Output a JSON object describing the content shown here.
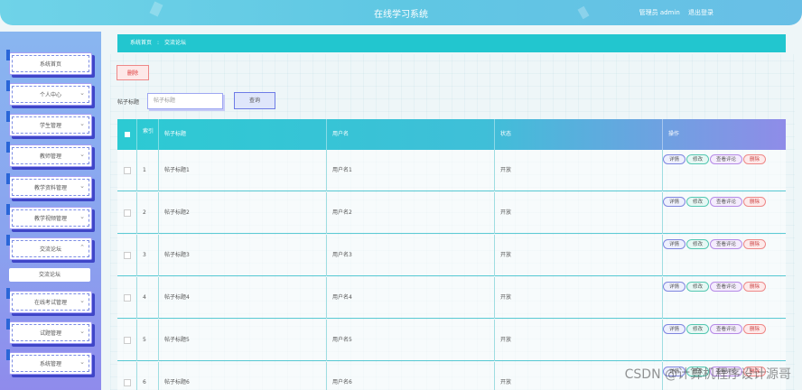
{
  "header": {
    "title": "在线学习系统",
    "user": "管理员 admin",
    "logout": "退出登录"
  },
  "sidebar": {
    "items": [
      {
        "label": "系统首页",
        "chevron": false
      },
      {
        "label": "个人中心",
        "chevron": true
      },
      {
        "label": "学生管理",
        "chevron": true
      },
      {
        "label": "教师管理",
        "chevron": true
      },
      {
        "label": "教学资料管理",
        "chevron": true
      },
      {
        "label": "教学视频管理",
        "chevron": true
      },
      {
        "label": "交流论坛",
        "chevron": true,
        "expanded": true
      },
      {
        "label": "在线考试管理",
        "chevron": true
      },
      {
        "label": "试题管理",
        "chevron": true
      },
      {
        "label": "系统管理",
        "chevron": true
      }
    ],
    "submenu": "交流论坛"
  },
  "breadcrumb": {
    "home": "系统首页",
    "sep": ":",
    "current": "交流论坛"
  },
  "toolbar": {
    "delete_label": "删除"
  },
  "search": {
    "label": "帖子标题",
    "placeholder": "帖子标题",
    "button": "查询"
  },
  "table": {
    "columns": [
      "索引",
      "帖子标题",
      "用户名",
      "状态",
      "操作"
    ],
    "rows": [
      {
        "index": "1",
        "title": "帖子标题1",
        "user": "用户名1",
        "status": "开放"
      },
      {
        "index": "2",
        "title": "帖子标题2",
        "user": "用户名2",
        "status": "开放"
      },
      {
        "index": "3",
        "title": "帖子标题3",
        "user": "用户名3",
        "status": "开放"
      },
      {
        "index": "4",
        "title": "帖子标题4",
        "user": "用户名4",
        "status": "开放"
      },
      {
        "index": "5",
        "title": "帖子标题5",
        "user": "用户名5",
        "status": "开放"
      },
      {
        "index": "6",
        "title": "帖子标题6",
        "user": "用户名6",
        "status": "开放"
      }
    ],
    "actions": {
      "detail": "详情",
      "edit": "修改",
      "review": "查看评论",
      "delete": "删除"
    }
  },
  "watermark": "CSDN @计算机程序设计源哥"
}
